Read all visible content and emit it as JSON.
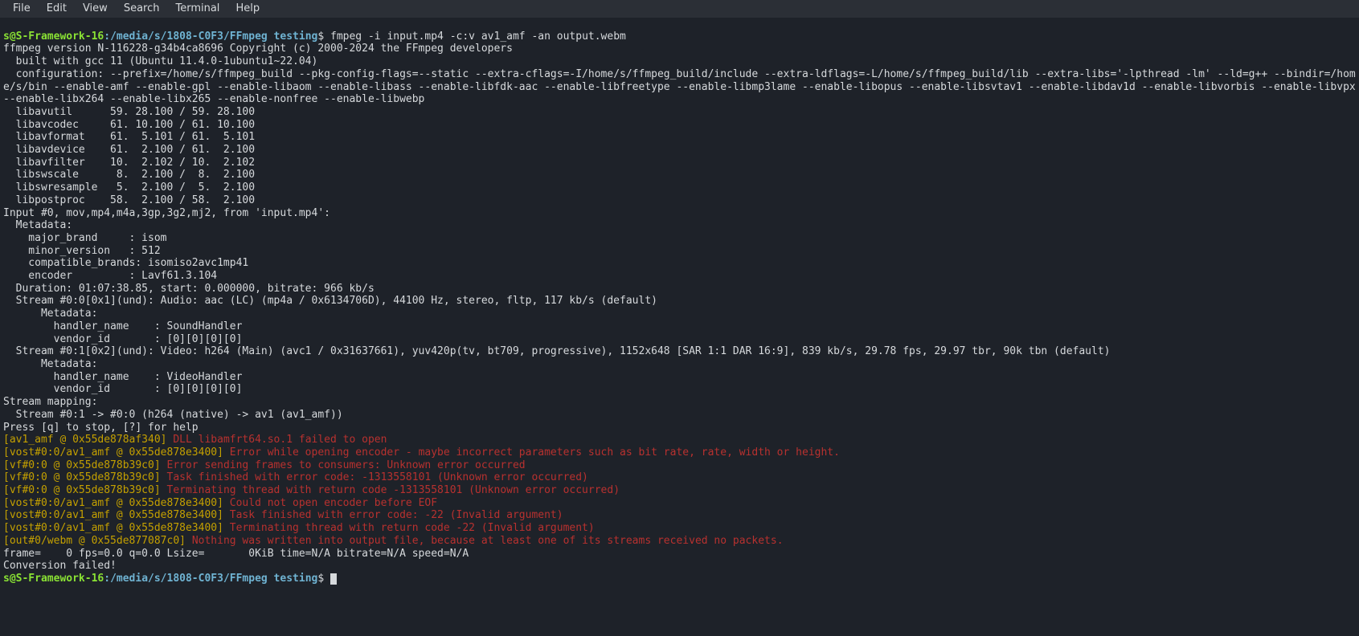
{
  "menubar": {
    "file": "File",
    "edit": "Edit",
    "view": "View",
    "search": "Search",
    "terminal": "Terminal",
    "help": "Help"
  },
  "prompt1": {
    "user": "s@S-Framework-16",
    "colon": ":",
    "path": "/media/s/1808-C0F3/FFmpeg testing",
    "dollar": "$ ",
    "command": "fmpeg -i input.mp4 -c:v av1_amf -an output.webm"
  },
  "out": {
    "l01": "ffmpeg version N-116228-g34b4ca8696 Copyright (c) 2000-2024 the FFmpeg developers",
    "l02": "  built with gcc 11 (Ubuntu 11.4.0-1ubuntu1~22.04)",
    "l03": "  configuration: --prefix=/home/s/ffmpeg_build --pkg-config-flags=--static --extra-cflags=-I/home/s/ffmpeg_build/include --extra-ldflags=-L/home/s/ffmpeg_build/lib --extra-libs='-lpthread -lm' --ld=g++ --bindir=/home/s/bin --enable-amf --enable-gpl --enable-libaom --enable-libass --enable-libfdk-aac --enable-libfreetype --enable-libmp3lame --enable-libopus --enable-libsvtav1 --enable-libdav1d --enable-libvorbis --enable-libvpx --enable-libx264 --enable-libx265 --enable-nonfree --enable-libwebp",
    "l04": "  libavutil      59. 28.100 / 59. 28.100",
    "l05": "  libavcodec     61. 10.100 / 61. 10.100",
    "l06": "  libavformat    61.  5.101 / 61.  5.101",
    "l07": "  libavdevice    61.  2.100 / 61.  2.100",
    "l08": "  libavfilter    10.  2.102 / 10.  2.102",
    "l09": "  libswscale      8.  2.100 /  8.  2.100",
    "l10": "  libswresample   5.  2.100 /  5.  2.100",
    "l11": "  libpostproc    58.  2.100 / 58.  2.100",
    "l12": "Input #0, mov,mp4,m4a,3gp,3g2,mj2, from 'input.mp4':",
    "l13": "  Metadata:",
    "l14": "    major_brand     : isom",
    "l15": "    minor_version   : 512",
    "l16": "    compatible_brands: isomiso2avc1mp41",
    "l17": "    encoder         : Lavf61.3.104",
    "l18": "  Duration: 01:07:38.85, start: 0.000000, bitrate: 966 kb/s",
    "l19": "  Stream #0:0[0x1](und): Audio: aac (LC) (mp4a / 0x6134706D), 44100 Hz, stereo, fltp, 117 kb/s (default)",
    "l20": "      Metadata:",
    "l21": "        handler_name    : SoundHandler",
    "l22": "        vendor_id       : [0][0][0][0]",
    "l23": "  Stream #0:1[0x2](und): Video: h264 (Main) (avc1 / 0x31637661), yuv420p(tv, bt709, progressive), 1152x648 [SAR 1:1 DAR 16:9], 839 kb/s, 29.78 fps, 29.97 tbr, 90k tbn (default)",
    "l24": "      Metadata:",
    "l25": "        handler_name    : VideoHandler",
    "l26": "        vendor_id       : [0][0][0][0]",
    "l27": "Stream mapping:",
    "l28": "  Stream #0:1 -> #0:0 (h264 (native) -> av1 (av1_amf))",
    "l29": "Press [q] to stop, [?] for help"
  },
  "err": {
    "l30_ctx": "[av1_amf @ 0x55de878af340] ",
    "l30_msg": "DLL libamfrt64.so.1 failed to open",
    "l31_ctx": "[vost#0:0/av1_amf @ 0x55de878e3400] ",
    "l31_msg": "Error while opening encoder - maybe incorrect parameters such as bit rate, rate, width or height.",
    "l32_ctx": "[vf#0:0 @ 0x55de878b39c0] ",
    "l32_msg": "Error sending frames to consumers: Unknown error occurred",
    "l33_ctx": "[vf#0:0 @ 0x55de878b39c0] ",
    "l33_msg": "Task finished with error code: -1313558101 (Unknown error occurred)",
    "l34_ctx": "[vf#0:0 @ 0x55de878b39c0] ",
    "l34_msg": "Terminating thread with return code -1313558101 (Unknown error occurred)",
    "l35_ctx": "[vost#0:0/av1_amf @ 0x55de878e3400] ",
    "l35_msg": "Could not open encoder before EOF",
    "l36_ctx": "[vost#0:0/av1_amf @ 0x55de878e3400] ",
    "l36_msg": "Task finished with error code: -22 (Invalid argument)",
    "l37_ctx": "[vost#0:0/av1_amf @ 0x55de878e3400] ",
    "l37_msg": "Terminating thread with return code -22 (Invalid argument)",
    "l38_ctx": "[out#0/webm @ 0x55de877087c0] ",
    "l38_msg": "Nothing was written into output file, because at least one of its streams received no packets."
  },
  "tail": {
    "l39": "frame=    0 fps=0.0 q=0.0 Lsize=       0KiB time=N/A bitrate=N/A speed=N/A",
    "l40": "Conversion failed!"
  },
  "prompt2": {
    "user": "s@S-Framework-16",
    "colon": ":",
    "path": "/media/s/1808-C0F3/FFmpeg testing",
    "dollar": "$ "
  }
}
